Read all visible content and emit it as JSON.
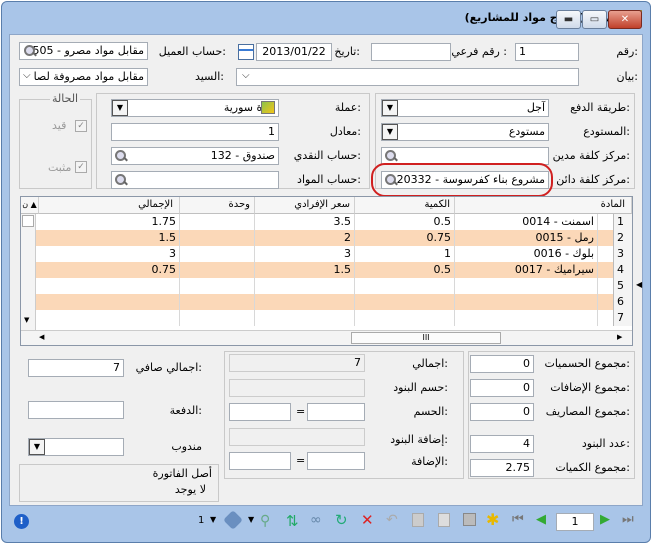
{
  "window": {
    "title": "فاتورة (اخراج مواد للمشاريع)"
  },
  "header": {
    "number_label": "رقم:",
    "number": "1",
    "subnumber_label": "رقم فرعي :",
    "subnumber": "",
    "date_label": "تاريخ:",
    "date": "2013/01/22",
    "client_account_label": "حساب العميل:",
    "client_account": "505 - مقابل مواد مصرو",
    "statement_label": "بيان:",
    "statement": "",
    "mr_label": "السيد:",
    "mr": "مقابل مواد مصروفة لصا"
  },
  "left_panel": {
    "payment_label": "طريقة الدفع:",
    "payment": "آجل",
    "warehouse_label": "المستودع:",
    "warehouse": "مستودع",
    "debit_center_label": "مركز كلفة مدين:",
    "debit_center": "",
    "credit_center_label": "مركز كلفة دائن:",
    "credit_center": "20332 - مشروع بناء كفرسوسة"
  },
  "mid_panel": {
    "currency_label": "عملة:",
    "currency": "ليرة سورية",
    "rate_label": "معادل:",
    "rate": "1",
    "cash_label": "حساب النقدي:",
    "cash": "132 - صندوق",
    "materials_label": "حساب المواد:",
    "materials": ""
  },
  "status": {
    "title": "الحالة",
    "posted": "قيد",
    "fixed": "مثبت"
  },
  "table": {
    "headers": [
      "المادة",
      "الكمية",
      "سعر الإفرادي",
      "وحدة",
      "الإجمالي",
      "ن"
    ],
    "rows": [
      {
        "n": "1",
        "item": "0014 - اسمنت",
        "qty": "0.5",
        "price": "3.5",
        "unit": "",
        "total": "1.75"
      },
      {
        "n": "2",
        "item": "0015 - رمل",
        "qty": "0.75",
        "price": "2",
        "unit": "",
        "total": "1.5"
      },
      {
        "n": "3",
        "item": "0016 - بلوك",
        "qty": "1",
        "price": "3",
        "unit": "",
        "total": "3"
      },
      {
        "n": "4",
        "item": "0017 - سيراميك",
        "qty": "0.5",
        "price": "1.5",
        "unit": "",
        "total": "0.75"
      },
      {
        "n": "5"
      },
      {
        "n": "6"
      },
      {
        "n": "7"
      }
    ],
    "scroll_glyph": "III"
  },
  "totals_right": {
    "discounts_label": "مجموع الحسميات:",
    "discounts": "0",
    "additions_label": "مجموع الإضافات:",
    "additions": "0",
    "expenses_label": "مجموع المصاريف:",
    "expenses": "0",
    "items_count_label": "عدد البنود:",
    "items_count": "4",
    "qty_total_label": "مجموع الكميات:",
    "qty_total": "2.75"
  },
  "totals_mid": {
    "total_label": "اجمالي:",
    "total": "7",
    "item_disc_label": "حسم البنود:",
    "item_disc": "",
    "disc_label": "الحسم:",
    "disc_a": "",
    "disc_b": "",
    "eq": "=",
    "item_add_label": "إضافة البنود:",
    "item_add": "",
    "add_label": "الإضافة:",
    "add_a": "",
    "add_b": ""
  },
  "totals_left": {
    "net_label": "اجمالي صافي:",
    "net": "7",
    "payment_label": "الدفعة:",
    "payment": "",
    "rep_label": "مندوب",
    "rep": "",
    "origin_label": "أصل الفاتورة",
    "origin": "لا يوجد"
  },
  "toolbar": {
    "page": "1",
    "count": "1"
  }
}
